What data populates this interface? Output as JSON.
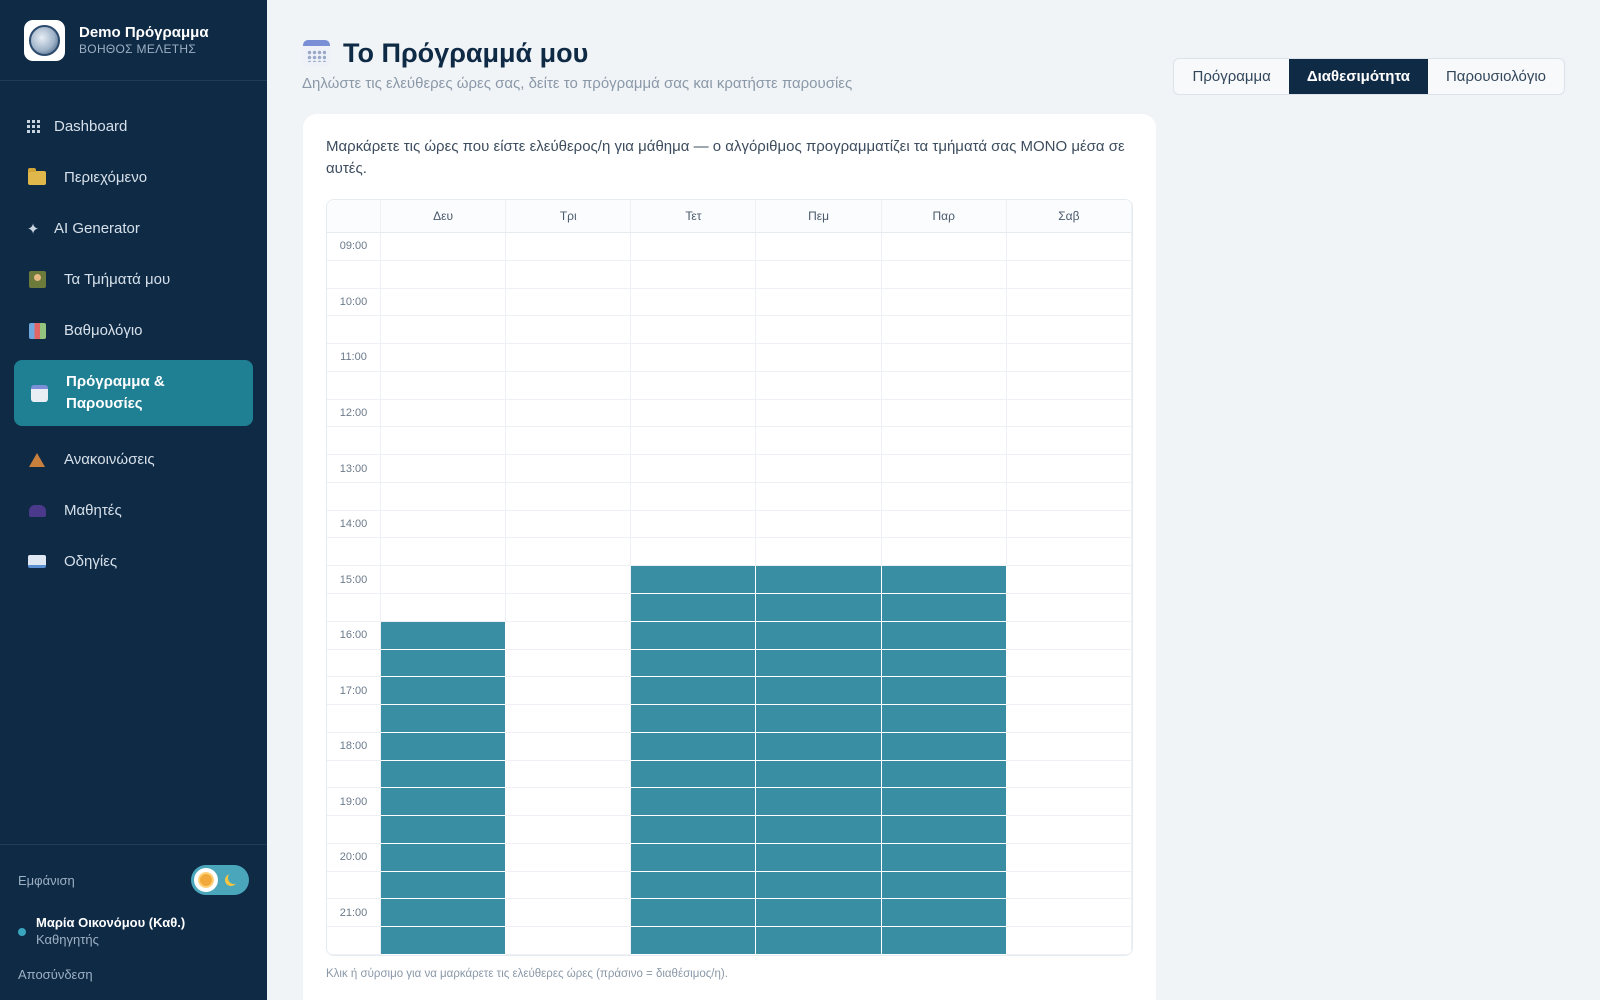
{
  "brand": {
    "title": "Demo Πρόγραμμα",
    "subtitle": "ΒΟΗΘΟΣ ΜΕΛΕΤΗΣ"
  },
  "nav": [
    {
      "label": "Dashboard",
      "icon": "grid-icon"
    },
    {
      "label": "Περιεχόμενο",
      "icon": "folder-icon"
    },
    {
      "label": "AI Generator",
      "icon": "sparkle-icon"
    },
    {
      "label": "Τα Τμήματά μου",
      "icon": "classroom-icon"
    },
    {
      "label": "Βαθμολόγιο",
      "icon": "bar-chart-icon"
    },
    {
      "label": "Πρόγραμμα & Παρουσίες",
      "icon": "calendar-icon",
      "active": true
    },
    {
      "label": "Ανακοινώσεις",
      "icon": "bell-icon"
    },
    {
      "label": "Μαθητές",
      "icon": "people-icon"
    },
    {
      "label": "Οδηγίες",
      "icon": "book-icon"
    }
  ],
  "footer": {
    "appearance_label": "Εμφάνιση",
    "user_name": "Μαρία Οικονόμου (Καθ.)",
    "user_role": "Καθηγητής",
    "logout": "Αποσύνδεση"
  },
  "header": {
    "title": "Το Πρόγραμμά μου",
    "subtitle": "Δηλώστε τις ελεύθερες ώρες σας, δείτε το πρόγραμμά σας και κρατήστε παρουσίες"
  },
  "tabs": [
    {
      "label": "Πρόγραμμα",
      "active": false
    },
    {
      "label": "Διαθεσιμότητα",
      "active": true
    },
    {
      "label": "Παρουσιολόγιο",
      "active": false
    }
  ],
  "availability": {
    "description": "Μαρκάρετε τις ώρες που είστε ελεύθερος/η για μάθημα — ο αλγόριθμος προγραμματίζει τα τμήματά σας ΜΟΝΟ μέσα σε αυτές.",
    "hint": "Κλικ ή σύρσιμο για να μαρκάρετε τις ελεύθερες ώρες (πράσινο = διαθέσιμος/η).",
    "days": [
      "Δευ",
      "Τρι",
      "Τετ",
      "Πεμ",
      "Παρ",
      "Σαβ"
    ],
    "times": [
      "09:00",
      "10:00",
      "11:00",
      "12:00",
      "13:00",
      "14:00",
      "15:00",
      "16:00",
      "17:00",
      "18:00",
      "19:00",
      "20:00",
      "21:00"
    ],
    "available_from": [
      "16:00",
      null,
      "15:00",
      "15:00",
      "15:00",
      null
    ],
    "available_until": "22:00",
    "selected_color": "#3a8ea3"
  }
}
